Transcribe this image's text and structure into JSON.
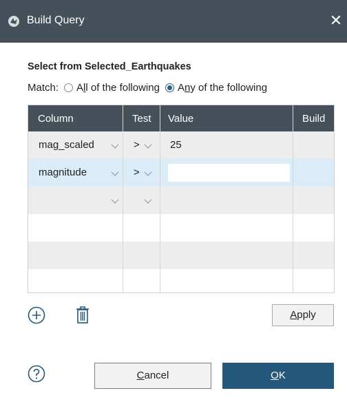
{
  "window": {
    "title": "Build Query",
    "close_glyph": "✕",
    "icon": "app-logo-icon"
  },
  "heading": "Select from Selected_Earthquakes",
  "match": {
    "label": "Match:",
    "options": [
      {
        "prefix": "A",
        "accel": "l",
        "rest": "l of the following",
        "checked": false
      },
      {
        "prefix": "A",
        "accel": "n",
        "rest": "y of the following",
        "checked": true
      }
    ]
  },
  "grid": {
    "headers": [
      "Column",
      "Test",
      "Value",
      "Build"
    ],
    "rows": [
      {
        "column": "mag_scaled",
        "test": ">",
        "value": "25",
        "selected": false
      },
      {
        "column": "magnitude",
        "test": ">",
        "value": "",
        "selected": true
      },
      {
        "column": "",
        "test": "",
        "value": "",
        "selected": false
      },
      {
        "column": "",
        "test": "",
        "value": "",
        "selected": false
      },
      {
        "column": "",
        "test": "",
        "value": "",
        "selected": false
      },
      {
        "column": "",
        "test": "",
        "value": "",
        "selected": false
      }
    ]
  },
  "buttons": {
    "apply": {
      "accel": "A",
      "rest": "pply"
    },
    "cancel": {
      "accel": "C",
      "rest": "ancel"
    },
    "ok": {
      "accel": "O",
      "rest": "K"
    }
  },
  "colors": {
    "header_bg": "#45505a",
    "selected_row": "#d9ecf8",
    "alt_row": "#ededed",
    "ok_bg": "#23587c"
  }
}
